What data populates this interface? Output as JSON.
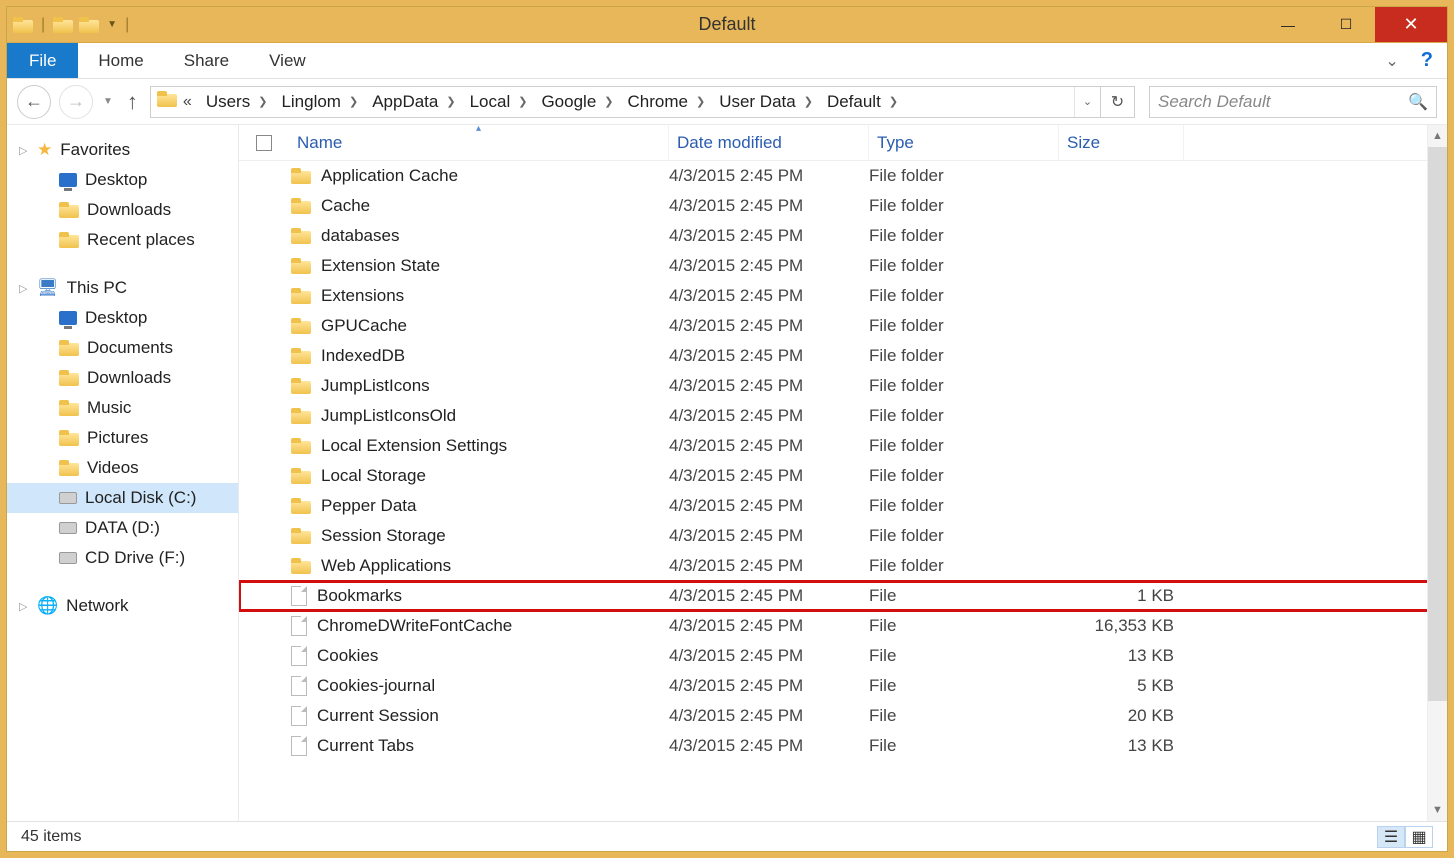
{
  "window_title": "Default",
  "ribbon": {
    "file": "File",
    "tabs": [
      "Home",
      "Share",
      "View"
    ]
  },
  "breadcrumb": [
    "Users",
    "Linglom",
    "AppData",
    "Local",
    "Google",
    "Chrome",
    "User Data",
    "Default"
  ],
  "search_placeholder": "Search Default",
  "columns": {
    "name": "Name",
    "date": "Date modified",
    "type": "Type",
    "size": "Size"
  },
  "sidebar": {
    "favorites": {
      "label": "Favorites",
      "items": [
        "Desktop",
        "Downloads",
        "Recent places"
      ]
    },
    "thispc": {
      "label": "This PC",
      "items": [
        "Desktop",
        "Documents",
        "Downloads",
        "Music",
        "Pictures",
        "Videos",
        "Local Disk (C:)",
        "DATA (D:)",
        "CD Drive (F:)"
      ]
    },
    "network": {
      "label": "Network"
    }
  },
  "selected_sidebar": "Local Disk (C:)",
  "rows": [
    {
      "name": "Application Cache",
      "date": "4/3/2015 2:45 PM",
      "type": "File folder",
      "size": "",
      "icon": "folder"
    },
    {
      "name": "Cache",
      "date": "4/3/2015 2:45 PM",
      "type": "File folder",
      "size": "",
      "icon": "folder"
    },
    {
      "name": "databases",
      "date": "4/3/2015 2:45 PM",
      "type": "File folder",
      "size": "",
      "icon": "folder"
    },
    {
      "name": "Extension State",
      "date": "4/3/2015 2:45 PM",
      "type": "File folder",
      "size": "",
      "icon": "folder"
    },
    {
      "name": "Extensions",
      "date": "4/3/2015 2:45 PM",
      "type": "File folder",
      "size": "",
      "icon": "folder"
    },
    {
      "name": "GPUCache",
      "date": "4/3/2015 2:45 PM",
      "type": "File folder",
      "size": "",
      "icon": "folder"
    },
    {
      "name": "IndexedDB",
      "date": "4/3/2015 2:45 PM",
      "type": "File folder",
      "size": "",
      "icon": "folder"
    },
    {
      "name": "JumpListIcons",
      "date": "4/3/2015 2:45 PM",
      "type": "File folder",
      "size": "",
      "icon": "folder"
    },
    {
      "name": "JumpListIconsOld",
      "date": "4/3/2015 2:45 PM",
      "type": "File folder",
      "size": "",
      "icon": "folder"
    },
    {
      "name": "Local Extension Settings",
      "date": "4/3/2015 2:45 PM",
      "type": "File folder",
      "size": "",
      "icon": "folder"
    },
    {
      "name": "Local Storage",
      "date": "4/3/2015 2:45 PM",
      "type": "File folder",
      "size": "",
      "icon": "folder"
    },
    {
      "name": "Pepper Data",
      "date": "4/3/2015 2:45 PM",
      "type": "File folder",
      "size": "",
      "icon": "folder"
    },
    {
      "name": "Session Storage",
      "date": "4/3/2015 2:45 PM",
      "type": "File folder",
      "size": "",
      "icon": "folder"
    },
    {
      "name": "Web Applications",
      "date": "4/3/2015 2:45 PM",
      "type": "File folder",
      "size": "",
      "icon": "folder"
    },
    {
      "name": "Bookmarks",
      "date": "4/3/2015 2:45 PM",
      "type": "File",
      "size": "1 KB",
      "icon": "file",
      "highlight": true
    },
    {
      "name": "ChromeDWriteFontCache",
      "date": "4/3/2015 2:45 PM",
      "type": "File",
      "size": "16,353 KB",
      "icon": "file"
    },
    {
      "name": "Cookies",
      "date": "4/3/2015 2:45 PM",
      "type": "File",
      "size": "13 KB",
      "icon": "file"
    },
    {
      "name": "Cookies-journal",
      "date": "4/3/2015 2:45 PM",
      "type": "File",
      "size": "5 KB",
      "icon": "file"
    },
    {
      "name": "Current Session",
      "date": "4/3/2015 2:45 PM",
      "type": "File",
      "size": "20 KB",
      "icon": "file"
    },
    {
      "name": "Current Tabs",
      "date": "4/3/2015 2:45 PM",
      "type": "File",
      "size": "13 KB",
      "icon": "file"
    }
  ],
  "status_text": "45 items"
}
